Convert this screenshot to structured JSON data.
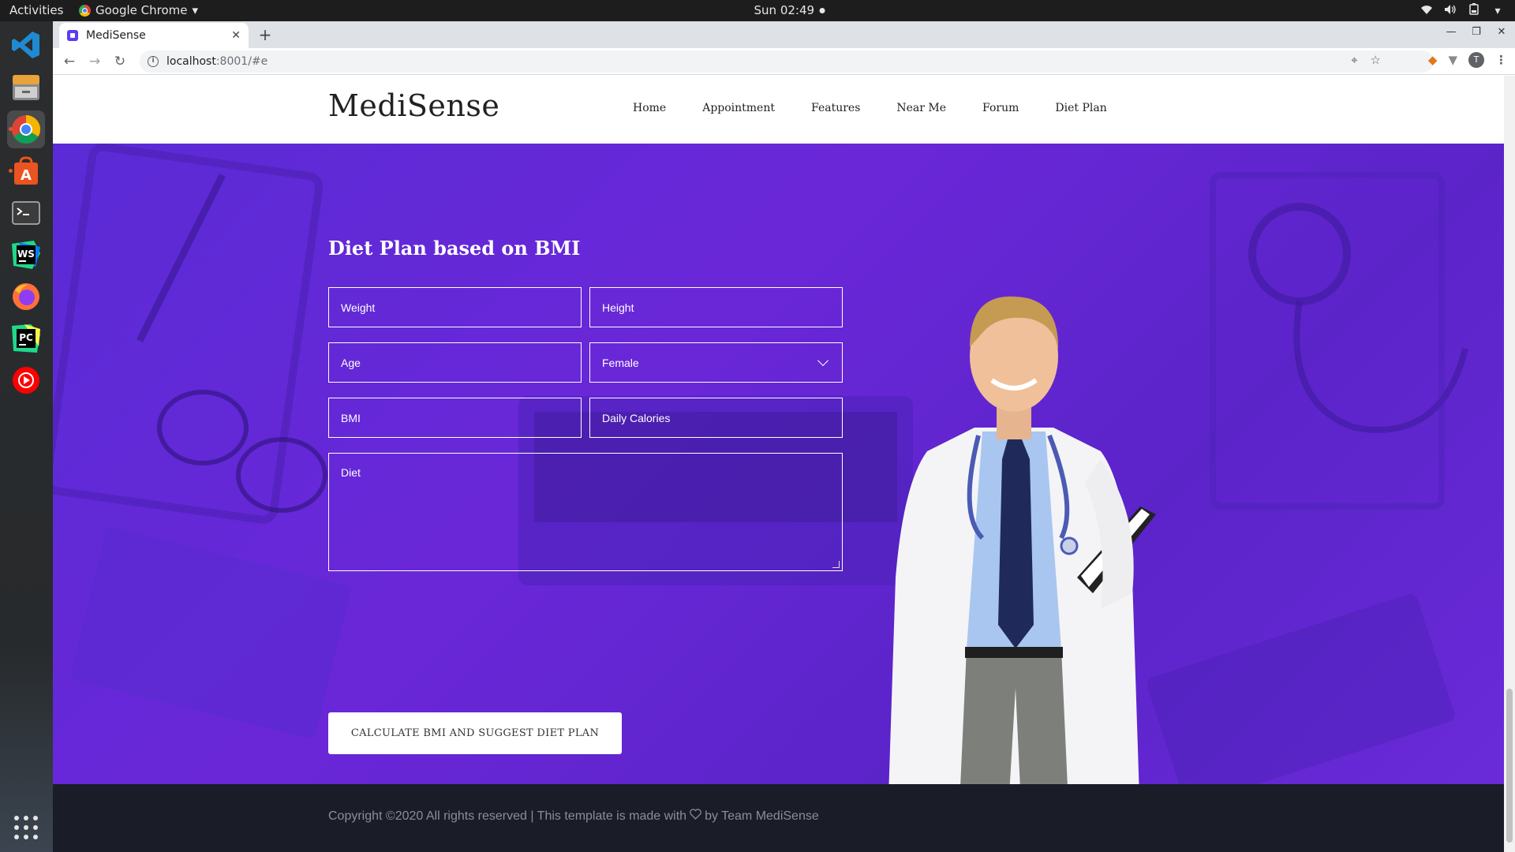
{
  "system": {
    "activities": "Activities",
    "app_name": "Google Chrome",
    "clock": "Sun 02:49"
  },
  "browser": {
    "tab_title": "MediSense",
    "url_host": "localhost",
    "url_path": ":8001/#e"
  },
  "site": {
    "brand": "MediSense",
    "nav": [
      "Home",
      "Appointment",
      "Features",
      "Near Me",
      "Forum",
      "Diet Plan"
    ],
    "section_title": "Diet Plan based on BMI",
    "form": {
      "weight_placeholder": "Weight",
      "height_placeholder": "Height",
      "age_placeholder": "Age",
      "gender_value": "Female",
      "bmi_placeholder": "BMI",
      "calories_placeholder": "Daily Calories",
      "diet_placeholder": "Diet",
      "submit_label": "CALCULATE BMI AND SUGGEST DIET PLAN"
    },
    "footer": {
      "text_before": "Copyright ©2020 All rights reserved | This template is made with",
      "text_after": "by Team MediSense"
    }
  },
  "colors": {
    "hero_purple": "#5f27d4",
    "footer_bg": "#1a1c27"
  },
  "icons": {
    "dock": [
      "vscode-icon",
      "files-icon",
      "chrome-icon",
      "software-center-icon",
      "terminal-icon",
      "webstorm-icon",
      "firefox-icon",
      "pycharm-icon",
      "youtube-music-icon",
      "show-apps-icon"
    ]
  }
}
